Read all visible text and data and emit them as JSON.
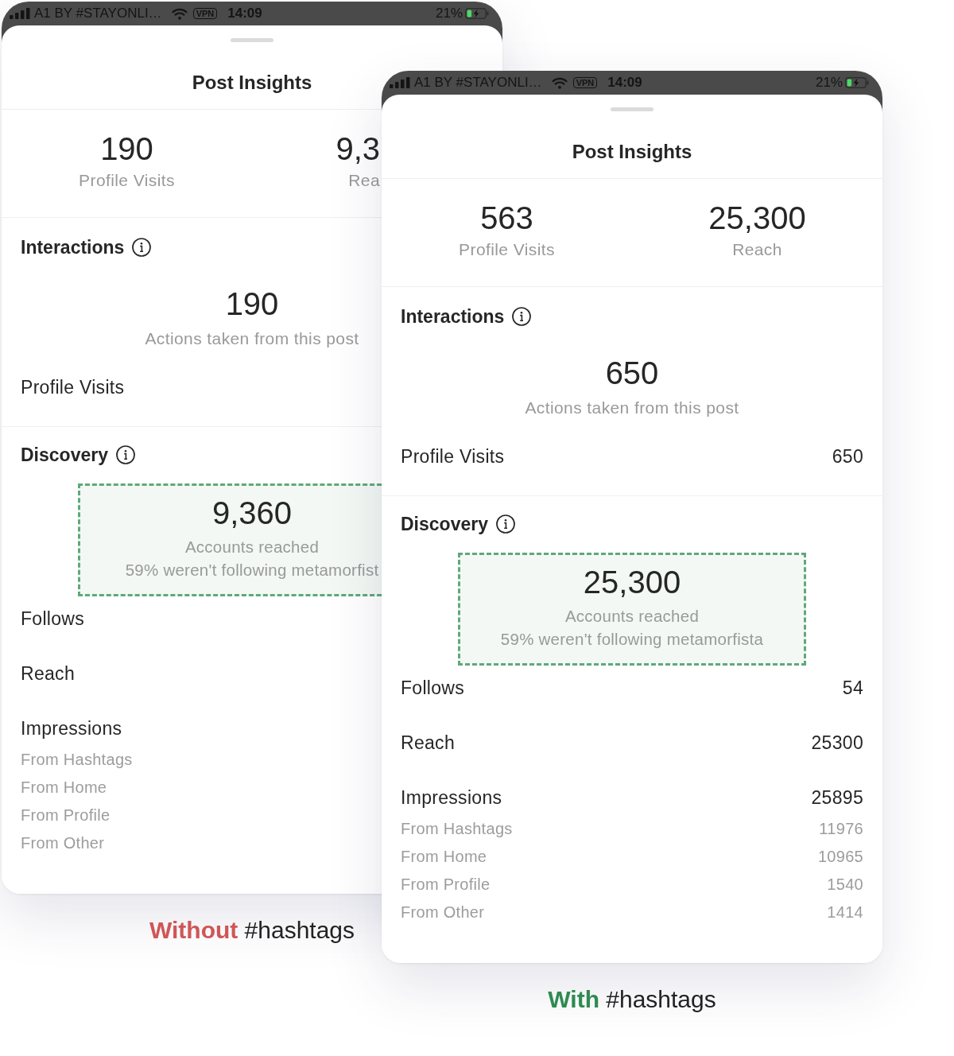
{
  "screens": [
    {
      "status_bar": {
        "carrier": "A1 BY #STAYONLI…",
        "vpn": "VPN",
        "time": "14:09",
        "battery": "21%"
      },
      "title": "Post Insights",
      "stats": [
        {
          "value": "190",
          "label": "Profile Visits"
        },
        {
          "value": "9,3",
          "label": "Rea"
        }
      ],
      "interactions": {
        "heading": "Interactions",
        "value": "190",
        "caption": "Actions taken from this post",
        "rows": [
          {
            "label": "Profile Visits"
          }
        ]
      },
      "discovery": {
        "heading": "Discovery",
        "highlight": {
          "value": "9,360",
          "caption": "Accounts reached",
          "note": "59% weren't following metamorfist"
        },
        "rows": [
          {
            "label": "Follows"
          },
          {
            "label": "Reach"
          },
          {
            "label": "Impressions",
            "children": [
              {
                "label": "From Hashtags"
              },
              {
                "label": "From Home"
              },
              {
                "label": "From Profile"
              },
              {
                "label": "From Other"
              }
            ]
          }
        ]
      },
      "caption": {
        "text": "**Without** #hashtags",
        "color": "#cf5656"
      }
    },
    {
      "status_bar": {
        "carrier": "A1 BY #STAYONLI…",
        "vpn": "VPN",
        "time": "14:09",
        "battery": "21%"
      },
      "title": "Post Insights",
      "stats": [
        {
          "value": "563",
          "label": "Profile Visits"
        },
        {
          "value": "25,300",
          "label": "Reach"
        }
      ],
      "interactions": {
        "heading": "Interactions",
        "value": "650",
        "caption": "Actions taken from this post",
        "rows": [
          {
            "label": "Profile Visits",
            "value": "650"
          }
        ]
      },
      "discovery": {
        "heading": "Discovery",
        "highlight": {
          "value": "25,300",
          "caption": "Accounts reached",
          "note": "59% weren't following metamorfista"
        },
        "rows": [
          {
            "label": "Follows",
            "value": "54"
          },
          {
            "label": "Reach",
            "value": "25300"
          },
          {
            "label": "Impressions",
            "value": "25895",
            "children": [
              {
                "label": "From Hashtags",
                "value": "11976"
              },
              {
                "label": "From Home",
                "value": "10965"
              },
              {
                "label": "From Profile",
                "value": "1540"
              },
              {
                "label": "From Other",
                "value": "1414"
              }
            ]
          }
        ]
      },
      "caption": {
        "text": "**With** #hashtags",
        "color": "#2e8b50"
      }
    }
  ]
}
